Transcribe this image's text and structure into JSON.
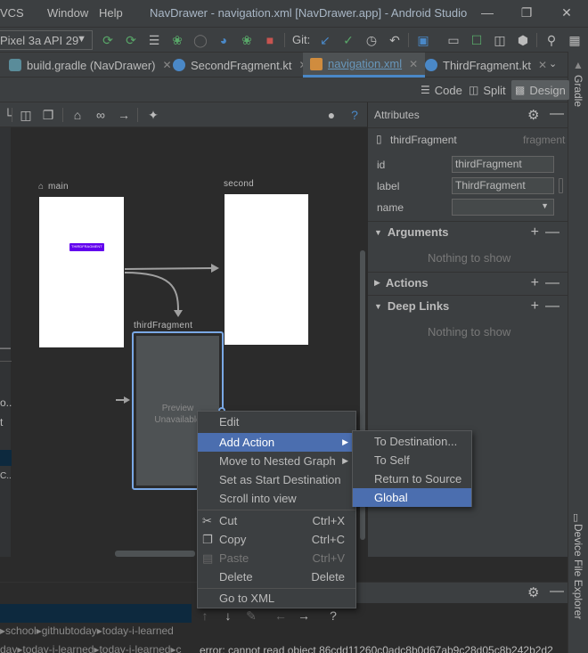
{
  "menu": {
    "items": [
      {
        "label": "VCS",
        "mnemonic": ""
      },
      {
        "label": "Window"
      },
      {
        "label": "Help"
      }
    ],
    "window_title": "NavDrawer - navigation.xml [NavDrawer.app] - Android Studio"
  },
  "toolbar": {
    "device": "Pixel 3a API 29",
    "git_label": "Git:"
  },
  "tabs": [
    {
      "label": "build.gradle (NavDrawer)",
      "icon": "gradle-icon"
    },
    {
      "label": "SecondFragment.kt",
      "icon": "kotlin-icon"
    },
    {
      "label": "navigation.xml",
      "icon": "xml-icon",
      "active": true
    },
    {
      "label": "ThirdFragment.kt",
      "icon": "kotlin-icon"
    }
  ],
  "view_modes": {
    "code": "Code",
    "split": "Split",
    "design": "Design",
    "active": "Design"
  },
  "canvas": {
    "destinations": {
      "main": "main",
      "second": "second",
      "third": "thirdFragment"
    },
    "main_button": "THIRDFRAGMENT",
    "third_preview": [
      "Preview",
      "Unavailable"
    ]
  },
  "attributes": {
    "title": "Attributes",
    "selected_name": "thirdFragment",
    "selected_type": "fragment",
    "id_label": "id",
    "id_value": "thirdFragment",
    "label_label": "label",
    "label_value": "ThirdFragment",
    "name_label": "name",
    "name_value": "",
    "sections": {
      "arguments": "Arguments",
      "actions": "Actions",
      "deep_links": "Deep Links"
    },
    "empty_text": "Nothing to show"
  },
  "context_menu": {
    "items": [
      {
        "label": "Edit"
      },
      {
        "label": "Add Action",
        "submenu": true,
        "selected": true
      },
      {
        "label": "Move to Nested Graph",
        "submenu": true
      },
      {
        "label": "Set as Start Destination"
      },
      {
        "label": "Scroll into view"
      },
      {
        "label": "Cut",
        "shortcut": "Ctrl+X"
      },
      {
        "label": "Copy",
        "shortcut": "Ctrl+C"
      },
      {
        "label": "Paste",
        "shortcut": "Ctrl+V",
        "disabled": true
      },
      {
        "label": "Delete",
        "shortcut": "Delete"
      },
      {
        "label": "Go to XML"
      }
    ]
  },
  "submenu": {
    "items": [
      {
        "label": "To Destination..."
      },
      {
        "label": "To Self"
      },
      {
        "label": "Return to Source"
      },
      {
        "label": "Global",
        "selected": true
      }
    ]
  },
  "left_panel": {
    "snips": [
      "o..",
      "t",
      "C.."
    ]
  },
  "bottom": {
    "path1": "▸school▸githubtoday▸today-i-learned",
    "path2": "day▸today-i-learned▸today-i-learned▸c",
    "error": "error: cannot read object 86cdd11260c0adc8b0d67ab9c28d05c8b242b2d2"
  },
  "side_tools": {
    "gradle": "Gradle",
    "device_explorer": "Device File Explorer"
  },
  "colors": {
    "accent": "#4b6eaf",
    "selection_border": "#7aa8e5",
    "main_button": "#6200ee",
    "arrow": "#a0a0a0"
  }
}
